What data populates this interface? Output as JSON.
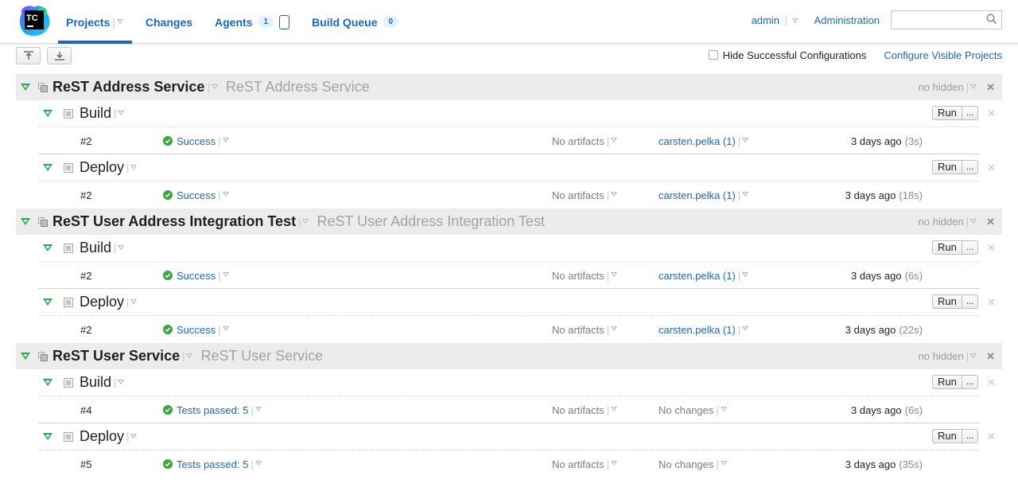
{
  "header": {
    "logo_text": "TC",
    "nav": [
      {
        "label": "Projects",
        "active": true,
        "has_dropdown": true
      },
      {
        "label": "Changes"
      },
      {
        "label": "Agents",
        "badge": "1"
      },
      {
        "label": "Build Queue",
        "badge": "0"
      }
    ],
    "user": "admin",
    "administration": "Administration",
    "search_placeholder": ""
  },
  "toolbar": {
    "collapse_all_icon": "collapse-all-icon",
    "expand_all_icon": "expand-all-icon",
    "hide_successful_label": "Hide Successful Configurations",
    "hide_successful_checked": false,
    "configure_visible_label": "Configure Visible Projects"
  },
  "colors": {
    "link": "#1967c6",
    "success": "#3ca53f",
    "expand_triangle": "#28a745",
    "project_header_bg": "#ececee"
  },
  "projects": [
    {
      "name": "ReST Address Service",
      "description": "ReST Address Service",
      "hidden_label": "no hidden",
      "build_types": [
        {
          "name": "Build",
          "run_label": "Run",
          "more_label": "...",
          "build": {
            "number": "#2",
            "status": "Success",
            "artifacts": "No artifacts",
            "changes": "carsten.pelka (1)",
            "changes_is_link": true,
            "time": "3 days ago",
            "duration": "(3s)"
          }
        },
        {
          "name": "Deploy",
          "run_label": "Run",
          "more_label": "...",
          "build": {
            "number": "#2",
            "status": "Success",
            "artifacts": "No artifacts",
            "changes": "carsten.pelka (1)",
            "changes_is_link": true,
            "time": "3 days ago",
            "duration": "(18s)"
          }
        }
      ]
    },
    {
      "name": "ReST User Address Integration Test",
      "description": "ReST User Address Integration Test",
      "hidden_label": "no hidden",
      "build_types": [
        {
          "name": "Build",
          "run_label": "Run",
          "more_label": "...",
          "build": {
            "number": "#2",
            "status": "Success",
            "artifacts": "No artifacts",
            "changes": "carsten.pelka (1)",
            "changes_is_link": true,
            "time": "3 days ago",
            "duration": "(6s)"
          }
        },
        {
          "name": "Deploy",
          "run_label": "Run",
          "more_label": "...",
          "build": {
            "number": "#2",
            "status": "Success",
            "artifacts": "No artifacts",
            "changes": "carsten.pelka (1)",
            "changes_is_link": true,
            "time": "3 days ago",
            "duration": "(22s)"
          }
        }
      ]
    },
    {
      "name": "ReST User Service",
      "description": "ReST User Service",
      "hidden_label": "no hidden",
      "build_types": [
        {
          "name": "Build",
          "run_label": "Run",
          "more_label": "...",
          "build": {
            "number": "#4",
            "status": "Tests passed: 5",
            "artifacts": "No artifacts",
            "changes": "No changes",
            "changes_is_link": false,
            "time": "3 days ago",
            "duration": "(6s)"
          }
        },
        {
          "name": "Deploy",
          "run_label": "Run",
          "more_label": "...",
          "build": {
            "number": "#5",
            "status": "Tests passed: 5",
            "artifacts": "No artifacts",
            "changes": "No changes",
            "changes_is_link": false,
            "time": "3 days ago",
            "duration": "(35s)"
          }
        }
      ]
    }
  ]
}
